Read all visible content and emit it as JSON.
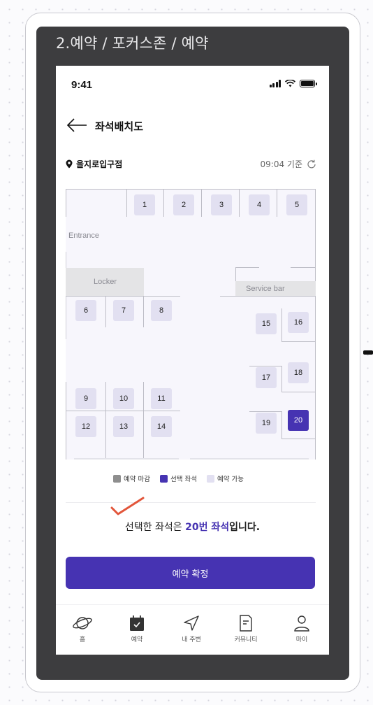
{
  "frame": {
    "title": "2.예약 / 포커스존 / 예약"
  },
  "status_bar": {
    "time": "9:41"
  },
  "header": {
    "title": "좌석배치도"
  },
  "branch": {
    "name": "을지로입구점",
    "time_basis": "09:04 기준"
  },
  "map": {
    "labels": {
      "entrance": "Entrance",
      "locker": "Locker",
      "service_bar": "Service bar"
    },
    "seats": [
      "1",
      "2",
      "3",
      "4",
      "5",
      "6",
      "7",
      "8",
      "9",
      "10",
      "11",
      "12",
      "13",
      "14",
      "15",
      "16",
      "17",
      "18",
      "19",
      "20"
    ],
    "selected_seat": "20"
  },
  "legend": {
    "reserved": "예약 마감",
    "selected": "선택 좌석",
    "available": "예약 가능"
  },
  "colors": {
    "reserved": "#8e8e8e",
    "selected": "#4633b2",
    "available": "#e2e0f1",
    "accent": "#4633b2",
    "check": "#e2553a"
  },
  "selection": {
    "prefix": "선택한 좌석은 ",
    "seat": "20번 좌석",
    "suffix": "입니다."
  },
  "confirm_button": "예약 확정",
  "tabbar": [
    {
      "label": "홈",
      "icon": "planet-icon"
    },
    {
      "label": "예약",
      "icon": "calendar-check-icon"
    },
    {
      "label": "내 주변",
      "icon": "navigation-icon"
    },
    {
      "label": "커뮤니티",
      "icon": "document-icon"
    },
    {
      "label": "마이",
      "icon": "user-icon"
    }
  ]
}
